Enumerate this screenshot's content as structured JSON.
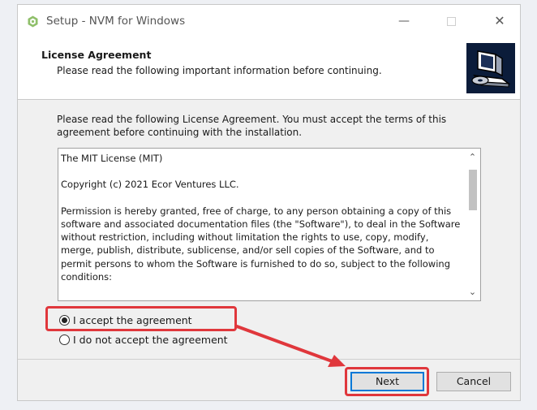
{
  "window": {
    "title": "Setup - NVM for Windows",
    "controls": {
      "minimize": "—",
      "close": "✕"
    }
  },
  "header": {
    "title": "License Agreement",
    "subtitle": "Please read the following important information before continuing."
  },
  "body": {
    "intro": "Please read the following License Agreement. You must accept the terms of this agreement before continuing with the installation."
  },
  "license": {
    "paragraphs": [
      "The MIT License (MIT)",
      "Copyright (c) 2021 Ecor Ventures LLC.",
      "Permission is hereby granted, free of charge, to any person obtaining a copy of this software and associated documentation files (the \"Software\"), to deal in the Software without restriction, including without limitation the rights to use, copy, modify, merge, publish, distribute, sublicense, and/or sell copies of the Software, and to permit persons to whom the Software is furnished to do so, subject to the following conditions:"
    ]
  },
  "options": {
    "accept": "I accept the agreement",
    "decline": "I do not accept the agreement",
    "selected": "accept"
  },
  "buttons": {
    "next": "Next",
    "cancel": "Cancel"
  },
  "annotation_color": "#e0373c",
  "icons": [
    "nvm-app-icon",
    "computer-disc-icon",
    "scroll-up-icon",
    "scroll-down-icon"
  ]
}
